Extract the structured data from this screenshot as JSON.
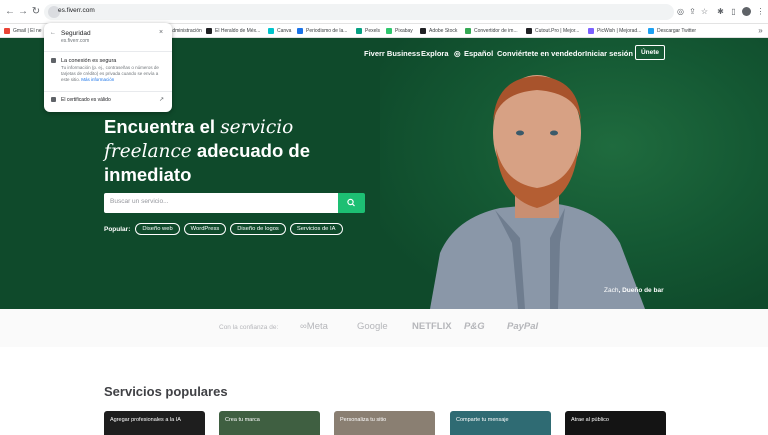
{
  "browser": {
    "url": "es.fiverr.com",
    "bookmarks": [
      {
        "label": "Gmail | El ne",
        "color": "#ea4335"
      },
      {
        "label": "Administración",
        "color": "#5f6368"
      },
      {
        "label": "El Heraldo de Méx...",
        "color": "#202124"
      },
      {
        "label": "Canva",
        "color": "#00c4cc"
      },
      {
        "label": "Periodismo de la...",
        "color": "#1a73e8"
      },
      {
        "label": "Pexels",
        "color": "#05a081"
      },
      {
        "label": "Pixabay",
        "color": "#2ec66d"
      },
      {
        "label": "Adobe Stock",
        "color": "#202124"
      },
      {
        "label": "Convertidor de im...",
        "color": "#34a853"
      },
      {
        "label": "Cutout.Pro | Mejor...",
        "color": "#202124"
      },
      {
        "label": "PicWish | Mejorad...",
        "color": "#7b61ff"
      },
      {
        "label": "Descargar Twitter",
        "color": "#1da1f2"
      }
    ]
  },
  "site_info_popup": {
    "back_arrow": "←",
    "title": "Seguridad",
    "domain": "es.fiverr.com",
    "close": "×",
    "connection_title": "La conexión es segura",
    "connection_body": "Tu información (p. ej., contraseñas o números de tarjetas de crédito) es privada cuando se envía a este sitio.",
    "more_info": "Más información",
    "certificate": "El certificado es válido",
    "external": "↗"
  },
  "header": {
    "nav": [
      "Fiverr Business",
      "Explora",
      "Español",
      "Conviértete en vendedor",
      "Iniciar sesión"
    ],
    "join": "Únete"
  },
  "hero": {
    "headline_part1": "Encuentra el ",
    "headline_italic1": "servicio freelance",
    "headline_part2": " adecuado de inmediato",
    "search_placeholder": "Buscar un servicio...",
    "popular_label": "Popular:",
    "popular_tags": [
      "Diseño web",
      "WordPress",
      "Diseño de logos",
      "Servicios de IA"
    ],
    "caption_name": "Zach",
    "caption_role": ", Dueño de bar"
  },
  "trust": {
    "label": "Con la confianza de:",
    "logos": [
      "Meta",
      "Google",
      "NETFLIX",
      "P&G",
      "PayPal"
    ]
  },
  "popular_services": {
    "title": "Servicios populares",
    "cards": [
      {
        "label": "Agregar profesionales a la IA",
        "color": "#1e1e1e"
      },
      {
        "label": "Crea tu marca",
        "color": "#3f5f41"
      },
      {
        "label": "Personaliza tu sitio",
        "color": "#8a7f72"
      },
      {
        "label": "Comparte tu mensaje",
        "color": "#2f6b73"
      },
      {
        "label": "Atrae al público",
        "color": "#141414"
      }
    ]
  },
  "colors": {
    "hero_green": "#0f4a2b",
    "accent_green": "#1dbf73"
  }
}
